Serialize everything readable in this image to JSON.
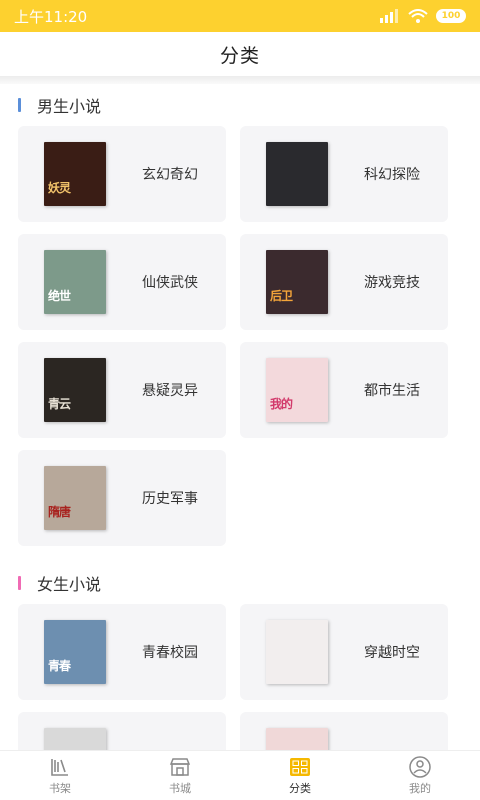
{
  "status_bar": {
    "time": "上午11:20",
    "battery": "100"
  },
  "header": {
    "title": "分类"
  },
  "sections": [
    {
      "title": "男生小说",
      "accent": "#5B8FD9",
      "items": [
        {
          "label": "玄幻奇幻",
          "cover_text": "妖灵",
          "front": "#3a1d15",
          "back": "#7a3a22",
          "text_color": "#f2c36b"
        },
        {
          "label": "科幻探险",
          "cover_text": "",
          "front": "#2a2a2e",
          "back": "#1b1b22",
          "text_color": "#f0d060"
        },
        {
          "label": "仙侠武侠",
          "cover_text": "绝世",
          "front": "#7d9a8a",
          "back": "#e6e2d5",
          "text_color": "#ffffff"
        },
        {
          "label": "游戏竞技",
          "cover_text": "后卫",
          "front": "#3b2a2e",
          "back": "#27405a",
          "text_color": "#f4a53a"
        },
        {
          "label": "悬疑灵异",
          "cover_text": "青云",
          "front": "#2b2622",
          "back": "#d9d6cf",
          "text_color": "#e8e2d6"
        },
        {
          "label": "都市生活",
          "cover_text": "我的",
          "front": "#f3d9dc",
          "back": "#f6d0d8",
          "text_color": "#d23a6b"
        },
        {
          "label": "历史军事",
          "cover_text": "隋唐",
          "front": "#b7a89a",
          "back": "#5a4a40",
          "text_color": "#a8231f"
        }
      ]
    },
    {
      "title": "女生小说",
      "accent": "#F06BB4",
      "items": [
        {
          "label": "青春校园",
          "cover_text": "青春",
          "front": "#6d8fb0",
          "back": "#d8d8d8",
          "text_color": "#ffffff"
        },
        {
          "label": "穿越时空",
          "cover_text": "",
          "front": "#f2eeee",
          "back": "#ece8e0",
          "text_color": "#c0392b"
        },
        {
          "label": "",
          "cover_text": "",
          "front": "#d9d9d9",
          "back": "#d9d9d9",
          "text_color": "#ffffff"
        },
        {
          "label": "",
          "cover_text": "",
          "front": "#f0d8d8",
          "back": "#e8c0c8",
          "text_color": "#ffffff"
        }
      ]
    }
  ],
  "tabs": [
    {
      "label": "书架",
      "icon": "bookshelf-icon",
      "active": false
    },
    {
      "label": "书城",
      "icon": "bookstore-icon",
      "active": false
    },
    {
      "label": "分类",
      "icon": "category-grid-icon",
      "active": true
    },
    {
      "label": "我的",
      "icon": "profile-icon",
      "active": false
    }
  ],
  "colors": {
    "brand": "#FDD12F",
    "card_bg": "#F5F5F7",
    "tab_active": "#F5B800"
  }
}
